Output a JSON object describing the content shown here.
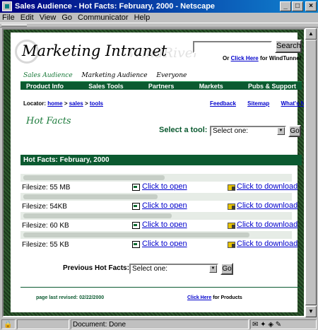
{
  "window": {
    "title": "Sales Audience - Hot Facts: February, 2000 - Netscape",
    "buttons": [
      "_",
      "□",
      "×"
    ]
  },
  "menu": [
    {
      "label": "File"
    },
    {
      "label": "Edit"
    },
    {
      "label": "View"
    },
    {
      "label": "Go"
    },
    {
      "label": "Communicator"
    },
    {
      "label": "Help"
    }
  ],
  "header": {
    "logo_text": "Marketing Intranet",
    "logo_watermark": "WindRiver",
    "search_button": "Search",
    "search_value": "",
    "search_sub_prefix": "Or",
    "search_sub_link": "Click Here",
    "search_sub_suffix": "for WindTunnel"
  },
  "subnav": [
    {
      "label": "Sales Audience",
      "active": true
    },
    {
      "label": "Marketing Audience",
      "active": false
    },
    {
      "label": "Everyone",
      "active": false
    }
  ],
  "mainnav": [
    "Product Info",
    "Sales Tools",
    "Partners",
    "Markets",
    "Pubs & Support"
  ],
  "locator": {
    "label": "Locator:",
    "crumbs": [
      "home",
      "sales",
      "tools"
    ],
    "separator": ">"
  },
  "utility_links": [
    "Feedback",
    "Sitemap",
    "What's New"
  ],
  "page": {
    "title": "Hot Facts",
    "select_tool_label": "Select a tool:",
    "select_tool_value": "Select one:",
    "go_label": "Go",
    "section_header": "Hot Facts: February, 2000"
  },
  "facts": [
    {
      "title": "blurred",
      "filesize_label": "Filesize:",
      "filesize": "55 MB",
      "open_label": "Click to open",
      "download_label": "Click to download"
    },
    {
      "title": "blurred",
      "filesize_label": "Filesize:",
      "filesize": "54KB",
      "open_label": "Click to open",
      "download_label": "Click to download"
    },
    {
      "title": "blurred",
      "filesize_label": "Filesize:",
      "filesize": "60 KB",
      "open_label": "Click to open",
      "download_label": "Click to download"
    },
    {
      "title": "blurred",
      "filesize_label": "Filesize:",
      "filesize": "55 KB",
      "open_label": "Click to open",
      "download_label": "Click to download"
    }
  ],
  "previous": {
    "label": "Previous Hot Facts:",
    "select_value": "Select one:",
    "go_label": "Go"
  },
  "footer": {
    "revised": "page last revised: 02/22/2000",
    "products_link": "Click Here",
    "products_suffix": "for Products"
  },
  "status": {
    "text": "Document: Done"
  }
}
